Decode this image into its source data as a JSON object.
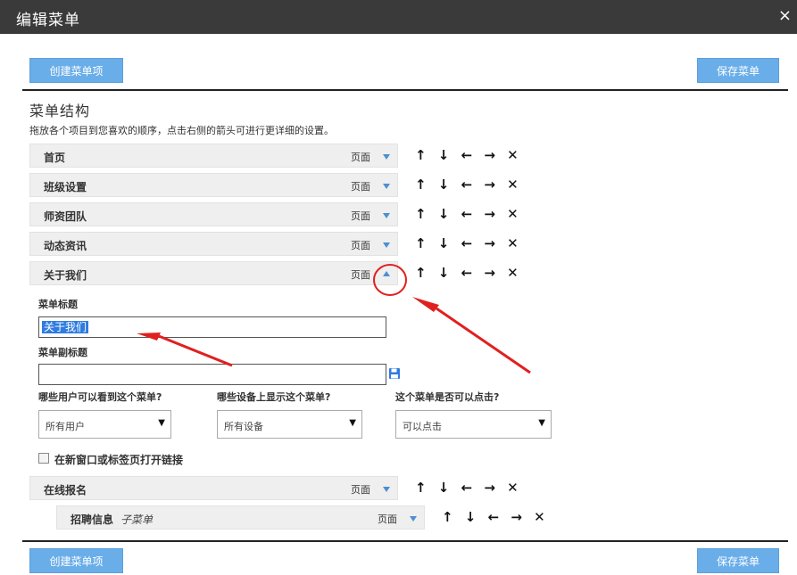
{
  "window": {
    "title": "编辑菜单",
    "close_glyph": "×"
  },
  "toolbar": {
    "create_label": "创建菜单项",
    "save_label": "保存菜单"
  },
  "structure": {
    "heading": "菜单结构",
    "description": "拖放各个项目到您喜欢的顺序，点击右侧的箭头可进行更详细的设置。"
  },
  "arrow_controls": "↑ ↓ ← → ✕",
  "items": [
    {
      "label": "首页",
      "type": "页面"
    },
    {
      "label": "班级设置",
      "type": "页面"
    },
    {
      "label": "师资团队",
      "type": "页面"
    },
    {
      "label": "动态资讯",
      "type": "页面"
    },
    {
      "label": "关于我们",
      "type": "页面"
    },
    {
      "label": "在线报名",
      "type": "页面"
    },
    {
      "label": "招聘信息",
      "sub_label": "子菜单",
      "type": "页面"
    }
  ],
  "editor": {
    "title_label": "菜单标题",
    "title_value": "关于我们",
    "subtitle_label": "菜单副标题",
    "subtitle_value": "",
    "users_label": "哪些用户可以看到这个菜单?",
    "users_value": "所有用户",
    "devices_label": "哪些设备上显示这个菜单?",
    "devices_value": "所有设备",
    "click_label": "这个菜单是否可以点击?",
    "click_value": "可以点击",
    "new_window_label": "在新窗口或标签页打开链接",
    "new_window_checked": false
  },
  "colors": {
    "accent": "#6aaee9",
    "annotation": "#e02020",
    "titlebar": "#3a3a3a"
  }
}
